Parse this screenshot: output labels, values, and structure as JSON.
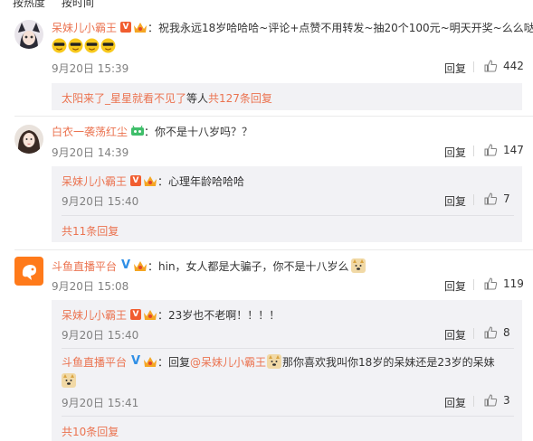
{
  "sort": {
    "hot": "按热度",
    "time": "按时间"
  },
  "comments": [
    {
      "user": "呆妹儿小霸王",
      "text": "：祝我永远18岁哈哈哈~评论+点赞不用转发~抽20个100元~明天开奖~么么哒",
      "time": "9月20日 15:39",
      "reply_label": "回复",
      "likes": "442",
      "more": {
        "user": "太阳来了_星星就看不见了",
        "text": " 等人 ",
        "count": "共127条回复"
      }
    },
    {
      "user": "白衣一袭荡红尘",
      "text": "：你不是十八岁吗？？",
      "time": "9月20日 14:39",
      "reply_label": "回复",
      "likes": "147",
      "replies": [
        {
          "user": "呆妹儿小霸王",
          "text": "：心理年龄哈哈哈",
          "time": "9月20日 15:40",
          "reply_label": "回复",
          "likes": "7"
        }
      ],
      "more": {
        "count": "共11条回复"
      }
    },
    {
      "user": "斗鱼直播平台",
      "text": "：hin，女人都是大骗子，你不是十八岁么",
      "time": "9月20日 15:08",
      "reply_label": "回复",
      "likes": "119",
      "replies": [
        {
          "user": "呆妹儿小霸王",
          "text": "：23岁也不老啊！！！！",
          "time": "9月20日 15:40",
          "reply_label": "回复",
          "likes": "8"
        },
        {
          "user": "斗鱼直播平台",
          "text_pre": "：回复",
          "mention": "@呆妹儿小霸王",
          "text_post": "那你喜欢我叫你18岁的呆妹还是23岁的呆妹",
          "time": "9月20日 15:41",
          "reply_label": "回复",
          "likes": "3"
        }
      ],
      "more": {
        "count": "共10条回复"
      }
    }
  ]
}
